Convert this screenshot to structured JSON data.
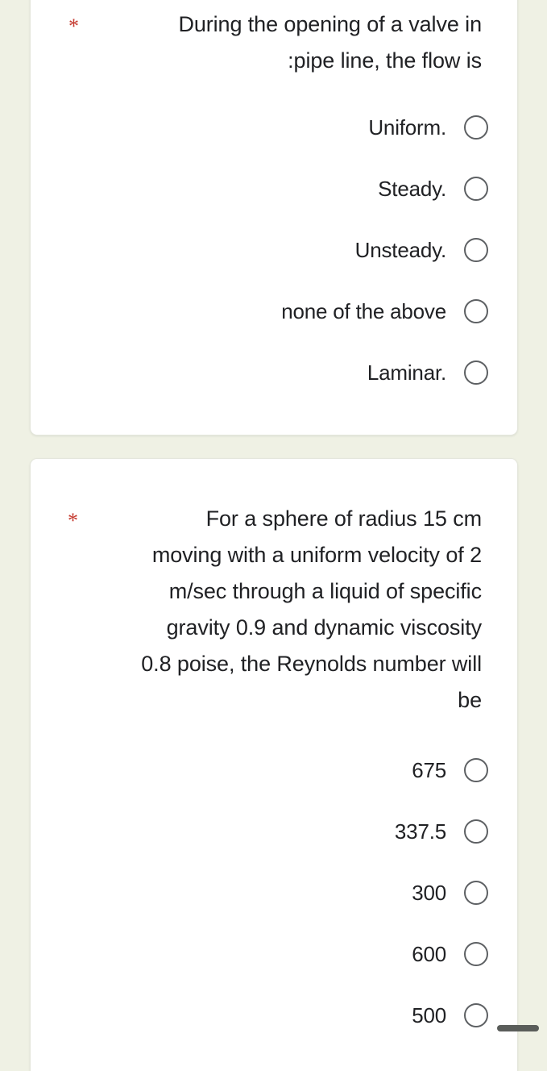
{
  "theme": {
    "page_background": "#eff1e4",
    "card_background": "#ffffff",
    "text_color": "#202124",
    "required_marker_color": "#c5392e",
    "radio_border_color": "#5d6063"
  },
  "questions": [
    {
      "required_marker": "*",
      "title": "During the opening of a valve in\n:pipe line, the flow is",
      "options": [
        {
          "label": "Uniform.",
          "selected": false
        },
        {
          "label": "Steady.",
          "selected": false
        },
        {
          "label": "Unsteady.",
          "selected": false
        },
        {
          "label": "none of the above",
          "selected": false
        },
        {
          "label": "Laminar.",
          "selected": false
        }
      ]
    },
    {
      "required_marker": "*",
      "title": "For a sphere of radius 15 cm\nmoving with a uniform velocity of 2\nm/sec through a liquid of specific\ngravity 0.9 and dynamic viscosity\n0.8 poise, the Reynolds number will\nbe",
      "options": [
        {
          "label": "675",
          "selected": false
        },
        {
          "label": "337.5",
          "selected": false
        },
        {
          "label": "300",
          "selected": false
        },
        {
          "label": "600",
          "selected": false
        },
        {
          "label": "500",
          "selected": false
        }
      ]
    }
  ]
}
